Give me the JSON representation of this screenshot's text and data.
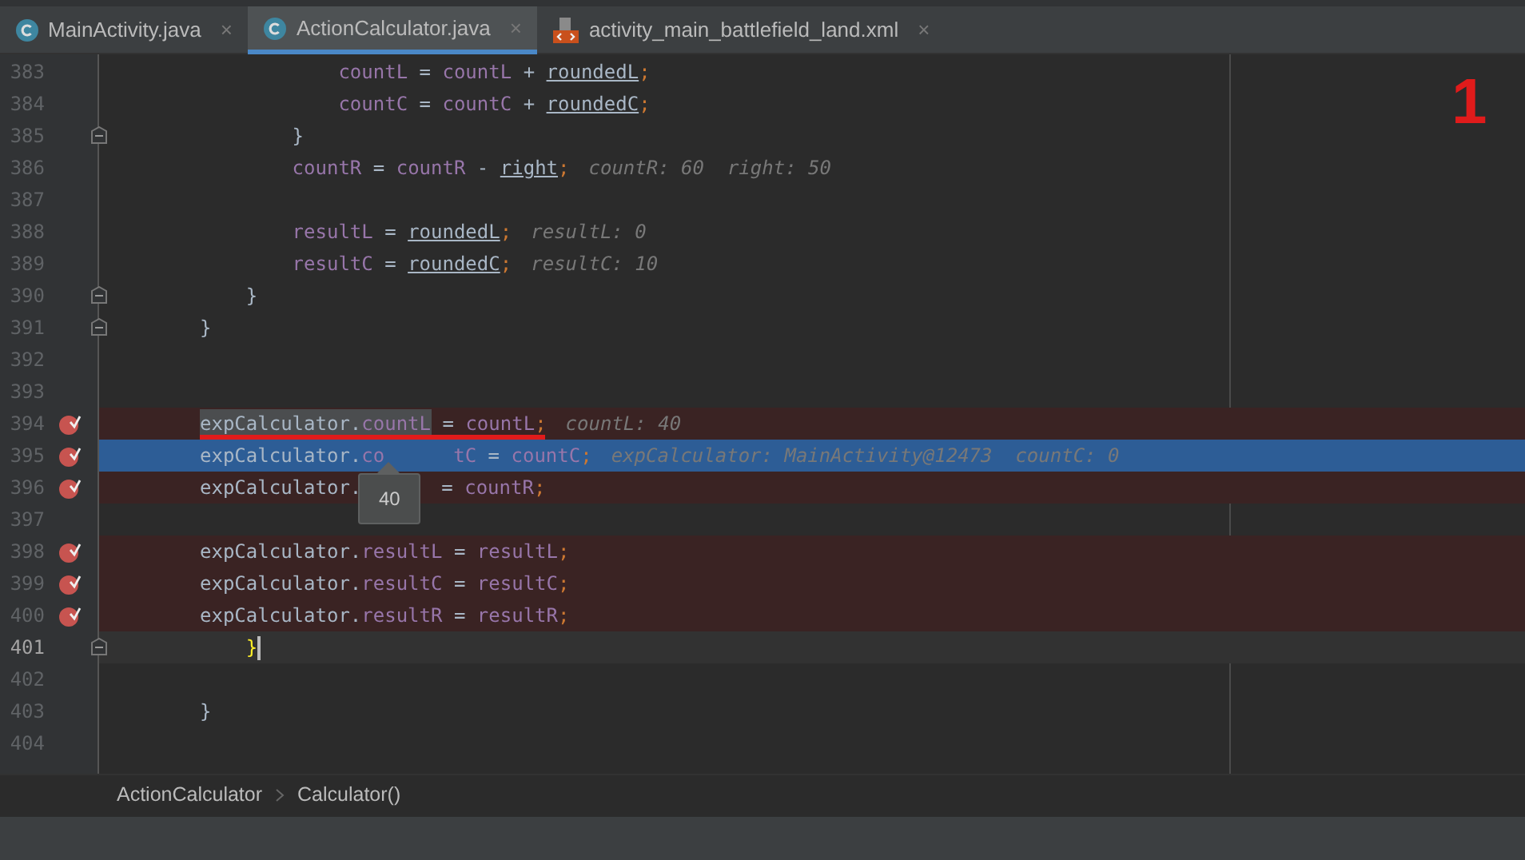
{
  "tabs": [
    {
      "label": "MainActivity.java",
      "kind": "java",
      "close": "×",
      "selected": false
    },
    {
      "label": "ActionCalculator.java",
      "kind": "java",
      "close": "×",
      "selected": true
    },
    {
      "label": "activity_main_battlefield_land.xml",
      "kind": "xml",
      "close": "×",
      "selected": false
    }
  ],
  "annotation": "1",
  "lines": [
    {
      "number": "383",
      "kind": "normal",
      "breakpoint": false,
      "fold": false,
      "segments": [
        {
          "t": "            countL",
          "kind": "field"
        },
        {
          "t": " = ",
          "kind": "plain"
        },
        {
          "t": "countL",
          "kind": "field"
        },
        {
          "t": " + ",
          "kind": "plain"
        },
        {
          "t": "roundedL",
          "kind": "local"
        },
        {
          "t": ";",
          "kind": "semi"
        }
      ]
    },
    {
      "number": "384",
      "kind": "normal",
      "breakpoint": false,
      "fold": false,
      "segments": [
        {
          "t": "            countC",
          "kind": "field"
        },
        {
          "t": " = ",
          "kind": "plain"
        },
        {
          "t": "countC",
          "kind": "field"
        },
        {
          "t": " + ",
          "kind": "plain"
        },
        {
          "t": "roundedC",
          "kind": "local"
        },
        {
          "t": ";",
          "kind": "semi"
        }
      ]
    },
    {
      "number": "385",
      "kind": "normal",
      "breakpoint": false,
      "fold": true,
      "segments": [
        {
          "t": "        }",
          "kind": "plain"
        }
      ]
    },
    {
      "number": "386",
      "kind": "normal",
      "breakpoint": false,
      "fold": false,
      "segments": [
        {
          "t": "        countR",
          "kind": "field"
        },
        {
          "t": " = ",
          "kind": "plain"
        },
        {
          "t": "countR",
          "kind": "field"
        },
        {
          "t": " - ",
          "kind": "plain"
        },
        {
          "t": "right",
          "kind": "local"
        },
        {
          "t": ";",
          "kind": "semi"
        },
        {
          "t": "countR: 60  right: 50",
          "kind": "hint"
        }
      ]
    },
    {
      "number": "387",
      "kind": "normal",
      "breakpoint": false,
      "fold": false
    },
    {
      "number": "388",
      "kind": "normal",
      "breakpoint": false,
      "fold": false,
      "segments": [
        {
          "t": "        resultL",
          "kind": "field"
        },
        {
          "t": " = ",
          "kind": "plain"
        },
        {
          "t": "roundedL",
          "kind": "local"
        },
        {
          "t": ";",
          "kind": "semi"
        },
        {
          "t": "resultL: 0",
          "kind": "hint"
        }
      ]
    },
    {
      "number": "389",
      "kind": "normal",
      "breakpoint": false,
      "fold": false,
      "segments": [
        {
          "t": "        resultC",
          "kind": "field"
        },
        {
          "t": " = ",
          "kind": "plain"
        },
        {
          "t": "roundedC",
          "kind": "local"
        },
        {
          "t": ";",
          "kind": "semi"
        },
        {
          "t": "resultC: 10",
          "kind": "hint"
        }
      ]
    },
    {
      "number": "390",
      "kind": "normal",
      "breakpoint": false,
      "fold": true,
      "segments": [
        {
          "t": "    }",
          "kind": "plain"
        }
      ]
    },
    {
      "number": "391",
      "kind": "normal",
      "breakpoint": false,
      "fold": true,
      "segments": [
        {
          "t": "}",
          "kind": "plain"
        }
      ]
    },
    {
      "number": "392",
      "kind": "normal",
      "breakpoint": false,
      "fold": false
    },
    {
      "number": "393",
      "kind": "normal",
      "breakpoint": false,
      "fold": false
    },
    {
      "number": "394",
      "kind": "breakpoint",
      "breakpoint": true,
      "fold": false,
      "segments": [
        {
          "t": "expCalculator.",
          "kind": "plain_sel"
        },
        {
          "t": "countL",
          "kind": "field_sel"
        },
        {
          "t": " = ",
          "kind": "plain"
        },
        {
          "t": "countL",
          "kind": "field"
        },
        {
          "t": ";",
          "kind": "semi"
        },
        {
          "t": "countL: 40",
          "kind": "hint"
        }
      ]
    },
    {
      "number": "395",
      "kind": "execution",
      "breakpoint": true,
      "fold": false,
      "segments": [
        {
          "t": "expCalculator.",
          "kind": "plain"
        },
        {
          "t": "co",
          "kind": "field"
        },
        {
          "t": "tC",
          "kind": "field_gap"
        },
        {
          "t": " = ",
          "kind": "plain"
        },
        {
          "t": "countC",
          "kind": "field"
        },
        {
          "t": ";",
          "kind": "semi"
        },
        {
          "t": "expCalculator: MainActivity@12473  countC: 0",
          "kind": "hint"
        }
      ]
    },
    {
      "number": "396",
      "kind": "breakpoint",
      "breakpoint": true,
      "fold": false,
      "segments": [
        {
          "t": "expCalculator.",
          "kind": "plain"
        },
        {
          "t": "= ",
          "kind": "plain_gap"
        },
        {
          "t": "countR",
          "kind": "field"
        },
        {
          "t": ";",
          "kind": "semi"
        }
      ]
    },
    {
      "number": "397",
      "kind": "normal",
      "breakpoint": false,
      "fold": false
    },
    {
      "number": "398",
      "kind": "breakpoint",
      "breakpoint": true,
      "fold": false,
      "segments": [
        {
          "t": "expCalculator.",
          "kind": "plain"
        },
        {
          "t": "resultL",
          "kind": "field"
        },
        {
          "t": " = ",
          "kind": "plain"
        },
        {
          "t": "resultL",
          "kind": "field"
        },
        {
          "t": ";",
          "kind": "semi"
        }
      ]
    },
    {
      "number": "399",
      "kind": "breakpoint",
      "breakpoint": true,
      "fold": false,
      "segments": [
        {
          "t": "expCalculator.",
          "kind": "plain"
        },
        {
          "t": "resultC",
          "kind": "field"
        },
        {
          "t": " = ",
          "kind": "plain"
        },
        {
          "t": "resultC",
          "kind": "field"
        },
        {
          "t": ";",
          "kind": "semi"
        }
      ]
    },
    {
      "number": "400",
      "kind": "breakpoint",
      "breakpoint": true,
      "fold": false,
      "segments": [
        {
          "t": "expCalculator.",
          "kind": "plain"
        },
        {
          "t": "resultR",
          "kind": "field"
        },
        {
          "t": " = ",
          "kind": "plain"
        },
        {
          "t": "resultR",
          "kind": "field"
        },
        {
          "t": ";",
          "kind": "semi"
        }
      ]
    },
    {
      "number": "401",
      "kind": "caret",
      "breakpoint": false,
      "fold": true,
      "segments": [
        {
          "t": "    }",
          "kind": "brace"
        }
      ]
    },
    {
      "number": "402",
      "kind": "normal",
      "breakpoint": false,
      "fold": false
    },
    {
      "number": "403",
      "kind": "normal",
      "breakpoint": false,
      "fold": false,
      "segments": [
        {
          "t": "}",
          "kind": "plain"
        }
      ]
    },
    {
      "number": "404",
      "kind": "normal",
      "breakpoint": false,
      "fold": false
    }
  ],
  "tooltip": "40",
  "breadcrumbs": [
    "ActionCalculator",
    "Calculator()"
  ]
}
